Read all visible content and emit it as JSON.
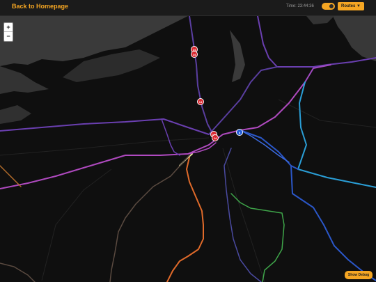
{
  "header": {
    "back_label": "Back to Homepage",
    "time_label": "Time: 23:44:36",
    "routes_label": "Routes ▼"
  },
  "map": {
    "zoom_in": "+",
    "zoom_out": "−",
    "markers": [
      {
        "label": "24",
        "color": "red"
      },
      {
        "label": "24",
        "color": "red"
      },
      {
        "label": "14",
        "color": "red"
      },
      {
        "label": "14",
        "color": "red"
      },
      {
        "label": "14",
        "color": "red"
      },
      {
        "label": "8",
        "color": "blue"
      }
    ]
  },
  "footer": {
    "debug_label": "Show Debug"
  },
  "colors": {
    "accent": "#f5a623",
    "background": "#0f0f0f",
    "water": "#3a3a3a"
  }
}
